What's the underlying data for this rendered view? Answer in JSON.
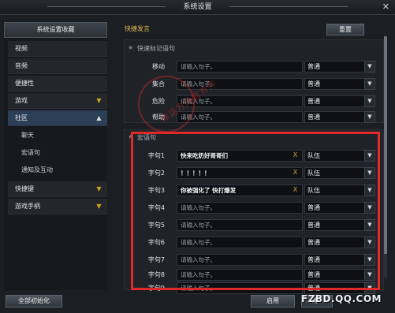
{
  "window": {
    "title": "系统设置",
    "close": "✕"
  },
  "sidebar": {
    "header": "系统设置收藏",
    "items": [
      {
        "label": "视频"
      },
      {
        "label": "音频"
      },
      {
        "label": "便捷性"
      },
      {
        "label": "游戏",
        "chevron": "▼"
      },
      {
        "label": "社区",
        "chevron": "▲"
      },
      {
        "label": "聊天"
      },
      {
        "label": "宏语句"
      },
      {
        "label": "通知及互动"
      },
      {
        "label": "快捷键",
        "chevron": "▼"
      },
      {
        "label": "游戏手柄",
        "chevron": "▼"
      }
    ]
  },
  "main": {
    "title": "快捷发言",
    "reset": "重置",
    "quick_section": {
      "title": "快速标记语句",
      "rows": [
        {
          "label": "移动",
          "placeholder": "请输入句子。",
          "channel": "普通"
        },
        {
          "label": "集合",
          "placeholder": "请输入句子。",
          "channel": "普通"
        },
        {
          "label": "危险",
          "placeholder": "请输入句子。",
          "channel": "普通"
        },
        {
          "label": "帮助",
          "placeholder": "请输入句子。",
          "channel": "普通"
        }
      ]
    },
    "macro_section": {
      "title": "宏语句",
      "rows": [
        {
          "label": "字句1",
          "value": "快来吃奶好哥哥们",
          "channel": "队伍"
        },
        {
          "label": "字句2",
          "value": "！！！！！",
          "channel": "队伍"
        },
        {
          "label": "字句3",
          "value": "你被强化了 快打爆发",
          "channel": "队伍"
        },
        {
          "label": "字句4",
          "placeholder": "请输入句子。",
          "channel": "普通"
        },
        {
          "label": "字句5",
          "placeholder": "请输入句子。",
          "channel": "普通"
        },
        {
          "label": "字句6",
          "placeholder": "请输入句子。",
          "channel": "普通"
        },
        {
          "label": "字句7",
          "placeholder": "请输入句子。",
          "channel": "普通"
        },
        {
          "label": "字句8",
          "placeholder": "请输入句子。",
          "channel": "普通"
        },
        {
          "label": "字句9",
          "placeholder": "请输入句子。",
          "channel": "普通"
        }
      ]
    },
    "clear_icon": "X",
    "dropdown_icon": "▼"
  },
  "footer": {
    "reset_all": "全部初始化",
    "apply": "启用",
    "confirm": "确"
  },
  "watermark": {
    "seal": "命运方舟官方作",
    "site": "FZBD.QQ.COM"
  },
  "colors": {
    "accent": "#e0b54a",
    "active_nav": "#2b3f57",
    "highlight_box": "#e02a2a"
  }
}
